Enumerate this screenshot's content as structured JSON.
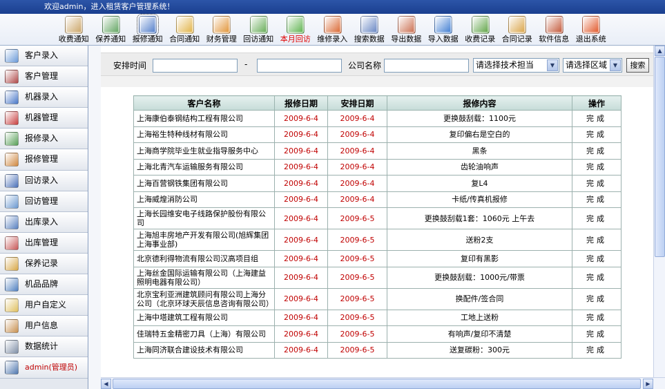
{
  "header": {
    "welcome": "欢迎admin，进入租赁客户管理系统！"
  },
  "toolbar": [
    {
      "label": "收费通知",
      "icon": "fee-notice-icon",
      "color": "#c8a060"
    },
    {
      "label": "保养通知",
      "icon": "maintenance-notice-icon",
      "color": "#5aa05a"
    },
    {
      "label": "报修通知",
      "icon": "repair-notice-icon",
      "color": "#4a78c8"
    },
    {
      "label": "合同通知",
      "icon": "contract-notice-icon",
      "color": "#e0b040"
    },
    {
      "label": "财务管理",
      "icon": "finance-icon",
      "color": "#e09030"
    },
    {
      "label": "回访通知",
      "icon": "revisit-notice-icon",
      "color": "#60a850"
    },
    {
      "label": "本月回访",
      "icon": "month-revisit-icon",
      "color": "#58b048"
    },
    {
      "label": "维修录入",
      "icon": "repair-entry-icon",
      "color": "#d86028"
    },
    {
      "label": "搜索数据",
      "icon": "search-data-icon",
      "color": "#6080c0"
    },
    {
      "label": "导出数据",
      "icon": "export-data-icon",
      "color": "#c86848"
    },
    {
      "label": "导入数据",
      "icon": "import-data-icon",
      "color": "#3878d0"
    },
    {
      "label": "收费记录",
      "icon": "fee-record-icon",
      "color": "#5aa040"
    },
    {
      "label": "合同记录",
      "icon": "contract-record-icon",
      "color": "#d8a040"
    },
    {
      "label": "软件信息",
      "icon": "home-icon",
      "color": "#c05030"
    },
    {
      "label": "退出系统",
      "icon": "exit-icon",
      "color": "#e05020"
    }
  ],
  "sidebar": [
    {
      "label": "客户录入",
      "icon": "customer-entry-icon",
      "color": "#6a9ad8"
    },
    {
      "label": "客户管理",
      "icon": "customer-manage-icon",
      "color": "#b04a4a"
    },
    {
      "label": "机器录入",
      "icon": "machine-entry-icon",
      "color": "#4a78c8"
    },
    {
      "label": "机器管理",
      "icon": "machine-manage-icon",
      "color": "#c84040"
    },
    {
      "label": "报修录入",
      "icon": "repair-entry-icon",
      "color": "#58a058"
    },
    {
      "label": "报修管理",
      "icon": "repair-manage-icon",
      "color": "#d08840"
    },
    {
      "label": "回访录入",
      "icon": "revisit-entry-icon",
      "color": "#4a70b8"
    },
    {
      "label": "回访管理",
      "icon": "revisit-manage-icon",
      "color": "#6a98d0"
    },
    {
      "label": "出库录入",
      "icon": "outbound-entry-icon",
      "color": "#5880c0"
    },
    {
      "label": "出库管理",
      "icon": "outbound-manage-icon",
      "color": "#c85858"
    },
    {
      "label": "保养记录",
      "icon": "maintenance-record-icon",
      "color": "#d8a848"
    },
    {
      "label": "机品品牌",
      "icon": "brand-icon",
      "color": "#5080c0"
    },
    {
      "label": "用户自定义",
      "icon": "user-custom-icon",
      "color": "#e0c060"
    },
    {
      "label": "用户信息",
      "icon": "user-info-icon",
      "color": "#c89050"
    },
    {
      "label": "数据统计",
      "icon": "statistics-icon",
      "color": "#8090a8"
    },
    {
      "label": "admin(管理员)",
      "icon": "admin-icon",
      "color": "#5078b0"
    }
  ],
  "search": {
    "schedule_label": "安排时间",
    "dash": "-",
    "company_label": "公司名称",
    "tech_select": "请选择技术担当",
    "area_select": "请选择区域",
    "search_button": "搜索"
  },
  "table": {
    "columns": [
      "客户名称",
      "报修日期",
      "安排日期",
      "报修内容",
      "操作"
    ],
    "rows": [
      {
        "name": "上海康伯泰钢结构工程有限公司",
        "repair_date": "2009-6-4",
        "arrange_date": "2009-6-4",
        "content": "更换鼓刮载：1100元",
        "op": "完成"
      },
      {
        "name": "上海裕生特种线材有限公司",
        "repair_date": "2009-6-4",
        "arrange_date": "2009-6-4",
        "content": "复印偏右是空白的",
        "op": "完成"
      },
      {
        "name": "上海商学院毕业生就业指导服务中心",
        "repair_date": "2009-6-4",
        "arrange_date": "2009-6-4",
        "content": "黑条",
        "op": "完成"
      },
      {
        "name": "上海北青汽车运输服务有限公司",
        "repair_date": "2009-6-4",
        "arrange_date": "2009-6-4",
        "content": "齿轮油响声",
        "op": "完成"
      },
      {
        "name": "上海百营钢铁集团有限公司",
        "repair_date": "2009-6-4",
        "arrange_date": "2009-6-4",
        "content": "复L4",
        "op": "完成"
      },
      {
        "name": "上海威煌消防公司",
        "repair_date": "2009-6-4",
        "arrange_date": "2009-6-4",
        "content": "卡纸/传真机报修",
        "op": "完成"
      },
      {
        "name": "上海长园维安电子线路保护股份有限公司",
        "repair_date": "2009-6-4",
        "arrange_date": "2009-6-5",
        "content": "更换鼓刮载1套：1060元 上午去",
        "op": "完成"
      },
      {
        "name": "上海旭丰房地产开发有限公司(旭辉集团上海事业部)",
        "repair_date": "2009-6-4",
        "arrange_date": "2009-6-5",
        "content": "送粉2支",
        "op": "完成"
      },
      {
        "name": "北京德利得物流有限公司汉高项目组",
        "repair_date": "2009-6-4",
        "arrange_date": "2009-6-5",
        "content": "复印有黑影",
        "op": "完成"
      },
      {
        "name": "上海丝金国际运输有限公司（上海建益照明电器有限公司）",
        "repair_date": "2009-6-4",
        "arrange_date": "2009-6-5",
        "content": "更换鼓刮载：1000元/带票",
        "op": "完成"
      },
      {
        "name": "北京宝利亚洲建筑顾问有限公司上海分公司（北京环球天辰信息咨询有限公司）",
        "repair_date": "2009-6-4",
        "arrange_date": "2009-6-5",
        "content": "换配件/签合同",
        "op": "完成"
      },
      {
        "name": "上海中塔建筑工程有限公司",
        "repair_date": "2009-6-4",
        "arrange_date": "2009-6-5",
        "content": "工地上送粉",
        "op": "完成"
      },
      {
        "name": "佳瑞特五金精密刀具（上海）有限公司",
        "repair_date": "2009-6-4",
        "arrange_date": "2009-6-5",
        "content": "有响声/复印不清楚",
        "op": "完成"
      },
      {
        "name": "上海同济联合建设技术有限公司",
        "repair_date": "2009-6-4",
        "arrange_date": "2009-6-5",
        "content": "送复碳粉：300元",
        "op": "完成"
      }
    ]
  }
}
